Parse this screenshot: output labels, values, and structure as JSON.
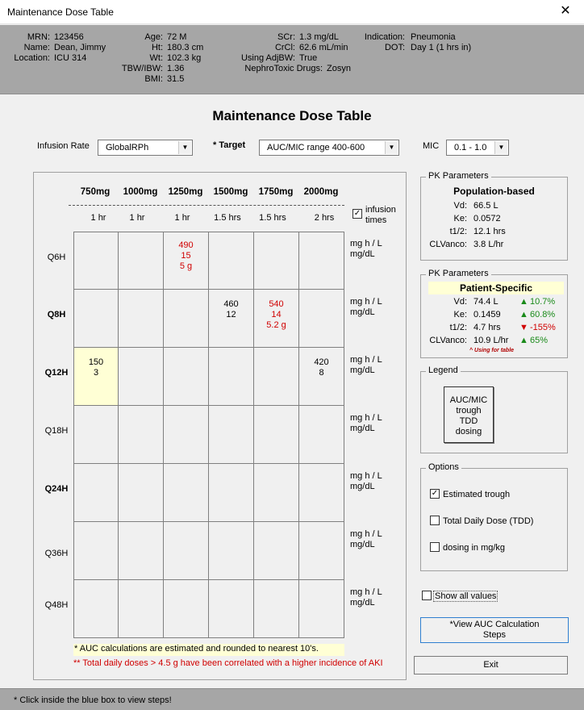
{
  "window": {
    "title": "Maintenance Dose Table",
    "close_glyph": "✕"
  },
  "patient": {
    "mrn_label": "MRN:",
    "mrn": "123456",
    "name_label": "Name:",
    "name": "Dean, Jimmy",
    "location_label": "Location:",
    "location": "ICU 314",
    "age_label": "Age:",
    "age": "72 M",
    "ht_label": "Ht:",
    "ht": "180.3 cm",
    "wt_label": "Wt:",
    "wt": "102.3 kg",
    "tbw_label": "TBW/IBW:",
    "tbw": "1.36",
    "bmi_label": "BMI:",
    "bmi": "31.5",
    "scr_label": "SCr:",
    "scr": "1.3 mg/dL",
    "crcl_label": "CrCl:",
    "crcl": "62.6 mL/min",
    "adjbw_label": "Using AdjBW:",
    "adjbw": "True",
    "nephro_label": "NephroToxic Drugs:",
    "nephro": "Zosyn",
    "indication_label": "Indication:",
    "indication": "Pneumonia",
    "dot_label": "DOT:",
    "dot": "Day 1 (1 hrs in)"
  },
  "main": {
    "title": "Maintenance Dose Table",
    "infusion_rate_label": "Infusion Rate",
    "infusion_rate_value": "GlobalRPh",
    "target_label": "* Target",
    "target_value": "AUC/MIC range 400-600",
    "mic_label": "MIC",
    "mic_value": "0.1 - 1.0",
    "infusion_times_label_1": "infusion",
    "infusion_times_label_2": "times"
  },
  "table": {
    "columns": [
      {
        "dose": "750mg",
        "time": "1 hr"
      },
      {
        "dose": "1000mg",
        "time": "1 hr"
      },
      {
        "dose": "1250mg",
        "time": "1 hr"
      },
      {
        "dose": "1500mg",
        "time": "1.5 hrs"
      },
      {
        "dose": "1750mg",
        "time": "1.5 hrs"
      },
      {
        "dose": "2000mg",
        "time": "2 hrs"
      }
    ],
    "rows": [
      {
        "label": "Q6H",
        "bold": false
      },
      {
        "label": "Q8H",
        "bold": true
      },
      {
        "label": "Q12H",
        "bold": true
      },
      {
        "label": "Q18H",
        "bold": false
      },
      {
        "label": "Q24H",
        "bold": true
      },
      {
        "label": "Q36H",
        "bold": false
      },
      {
        "label": "Q48H",
        "bold": false
      }
    ],
    "unit_line1": "mg h / L",
    "unit_line2": "mg/dL",
    "cells": {
      "q6h_1250": {
        "auc": "490",
        "trough": "15",
        "tdd": "5 g"
      },
      "q8h_1500": {
        "auc": "460",
        "trough": "12"
      },
      "q8h_1750": {
        "auc": "540",
        "trough": "14",
        "tdd": "5.2 g"
      },
      "q12h_750": {
        "auc": "150",
        "trough": "3"
      },
      "q12h_2000": {
        "auc": "420",
        "trough": "8"
      }
    },
    "footnote1": "* AUC calculations are estimated and rounded to nearest 10's.",
    "footnote2": "** Total daily doses > 4.5 g have been correlated with a higher incidence of AKI"
  },
  "pk_population": {
    "group_title": "PK Parameters",
    "heading": "Population-based",
    "vd_label": "Vd:",
    "vd": "66.5 L",
    "ke_label": "Ke:",
    "ke": "0.0572",
    "thalf_label": "t1/2:",
    "thalf": "12.1 hrs",
    "cl_label": "CLVanco:",
    "cl": "3.8 L/hr"
  },
  "pk_patient": {
    "group_title": "PK Parameters",
    "heading": "Patient-Specific",
    "vd_label": "Vd:",
    "vd": "74.4 L",
    "vd_change": "10.7%",
    "ke_label": "Ke:",
    "ke": "0.1459",
    "ke_change": "60.8%",
    "thalf_label": "t1/2:",
    "thalf": "4.7 hrs",
    "thalf_change": "-155%",
    "cl_label": "CLVanco:",
    "cl": "10.9 L/hr",
    "cl_change": "65%",
    "note": "^ Using for table",
    "up_glyph": "▲",
    "down_glyph": "▼"
  },
  "legend": {
    "group_title": "Legend",
    "line1": "AUC/MIC",
    "line2": "trough",
    "line3": "TDD",
    "line4": "dosing"
  },
  "options": {
    "group_title": "Options",
    "estimated_trough": "Estimated trough",
    "tdd": "Total Daily  Dose (TDD)",
    "dosing_mgkg": "dosing in mg/kg",
    "check_glyph": "✓"
  },
  "controls": {
    "show_all_values": "Show all values",
    "view_auc_line1": "*View AUC Calculation",
    "view_auc_line2": "Steps",
    "exit": "Exit"
  },
  "status": {
    "text": "* Click inside the blue box to view steps!"
  },
  "colors": {
    "header_bg": "#a6a6a6",
    "highlight": "#ffffd5",
    "red": "#d00000",
    "green": "#1a8a1a"
  }
}
